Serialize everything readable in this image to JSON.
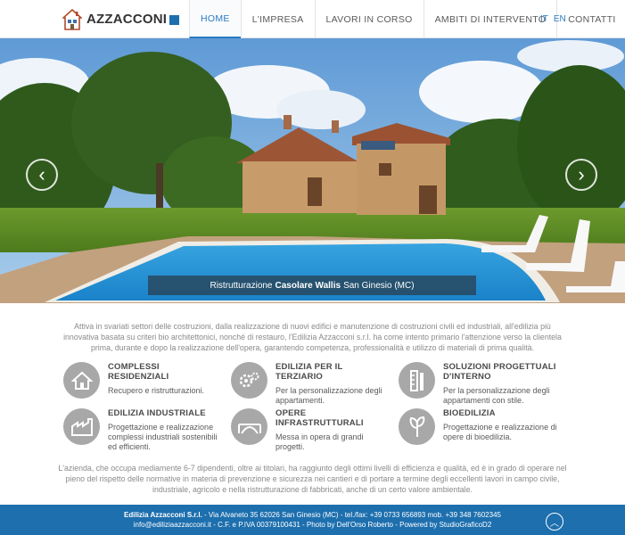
{
  "brand": {
    "name": "AZZACCONI"
  },
  "nav": {
    "items": [
      {
        "label": "HOME",
        "active": true
      },
      {
        "label": "L'IMPRESA"
      },
      {
        "label": "LAVORI IN CORSO"
      },
      {
        "label": "AMBITI DI INTERVENTO"
      },
      {
        "label": "CONTATTI"
      }
    ],
    "languages": [
      "IT",
      "EN"
    ]
  },
  "hero": {
    "caption_prefix": "Ristrutturazione",
    "caption_bold": "Casolare Wallis",
    "caption_suffix": "San Ginesio (MC)"
  },
  "intro": "Attiva in svariati settori delle costruzioni, dalla realizzazione di nuovi edifici e manutenzione di costruzioni civili ed industriali, all'edilizia più innovativa basata su criteri bio architettonici, nonché di restauro, l'Edilizia Azzacconi s.r.l. ha come intento primario l'attenzione verso la clientela prima, durante e dopo la realizzazione dell'opera, garantendo competenza, professionalità e utilizzo di materiali di prima qualità.",
  "services": [
    {
      "title": "COMPLESSI RESIDENZIALI",
      "desc": "Recupero e ristrutturazioni.",
      "icon": "house-icon"
    },
    {
      "title": "EDILIZIA PER IL TERZIARIO",
      "desc": "Per la personalizzazione degli appartamenti.",
      "icon": "gears-icon"
    },
    {
      "title": "SOLUZIONI PROGETTUALI D'INTERNO",
      "desc": "Per la personalizzazione degli appartamenti con stile.",
      "icon": "ruler-icon"
    },
    {
      "title": "EDILIZIA INDUSTRIALE",
      "desc": "Progettazione e realizzazione complessi industriali sostenibili ed efficienti.",
      "icon": "factory-icon"
    },
    {
      "title": "OPERE INFRASTRUTTURALI",
      "desc": "Messa in opera di grandi progetti.",
      "icon": "bridge-icon"
    },
    {
      "title": "BIOEDILIZIA",
      "desc": "Progettazione e realizzazione di opere di bioedilizia.",
      "icon": "leaf-icon"
    }
  ],
  "outro": "L'azienda, che occupa mediamente 6-7 dipendenti, oltre ai titolari, ha raggiunto degli ottimi livelli di efficienza e qualità, ed è in grado di operare nel pieno del rispetto delle normative in materia di prevenzione e sicurezza nei cantieri e di portare a termine degli eccellenti lavori in campo civile, industriale, agricolo e nella ristrutturazione di fabbricati, anche di un certo valore ambientale.",
  "footer": {
    "company": "Edilizia Azzacconi S.r.l.",
    "line1_rest": " - Via Alvaneto 35 62026 San Ginesio (MC) - tel./fax: +39 0733 656893 mob. +39 348 7602345",
    "line2": "info@ediliziaazzacconi.it - C.F. e P.IVA 00379100431 - Photo by Dell'Orso Roberto - Powered by StudioGraficoD2"
  },
  "colors": {
    "accent": "#2a7bc0",
    "footer": "#1d6fae"
  }
}
